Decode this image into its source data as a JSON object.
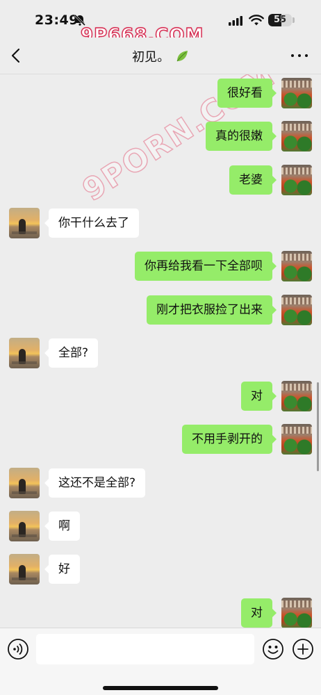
{
  "status_bar": {
    "time": "23:49",
    "battery_level": "55",
    "battery_fraction": 0.55
  },
  "watermark": {
    "top_logo": "9P668.COM",
    "diagonal": "9PORN.COM"
  },
  "nav": {
    "title": "初见。",
    "back_icon": "chevron-left-icon",
    "more_icon": "more-dots-icon",
    "title_icon": "leaf-icon"
  },
  "messages": [
    {
      "side": "self",
      "text": "很好看"
    },
    {
      "side": "self",
      "text": "真的很嫩"
    },
    {
      "side": "self",
      "text": "老婆"
    },
    {
      "side": "other",
      "text": "你干什么去了"
    },
    {
      "side": "self",
      "text": "你再给我看一下全部呗"
    },
    {
      "side": "self",
      "text": "刚才把衣服捡了出来"
    },
    {
      "side": "other",
      "text": "全部?"
    },
    {
      "side": "self",
      "text": "对"
    },
    {
      "side": "self",
      "text": "不用手剥开的"
    },
    {
      "side": "other",
      "text": "这还不是全部?"
    },
    {
      "side": "other",
      "text": "啊"
    },
    {
      "side": "other",
      "text": "好"
    },
    {
      "side": "self",
      "text": "对"
    }
  ],
  "input_bar": {
    "placeholder": "",
    "value": "",
    "voice_icon": "voice-icon",
    "emoji_icon": "emoji-icon",
    "plus_icon": "plus-icon"
  },
  "colors": {
    "self_bubble": "#95ec69",
    "other_bubble": "#ffffff",
    "background": "#ededed"
  }
}
